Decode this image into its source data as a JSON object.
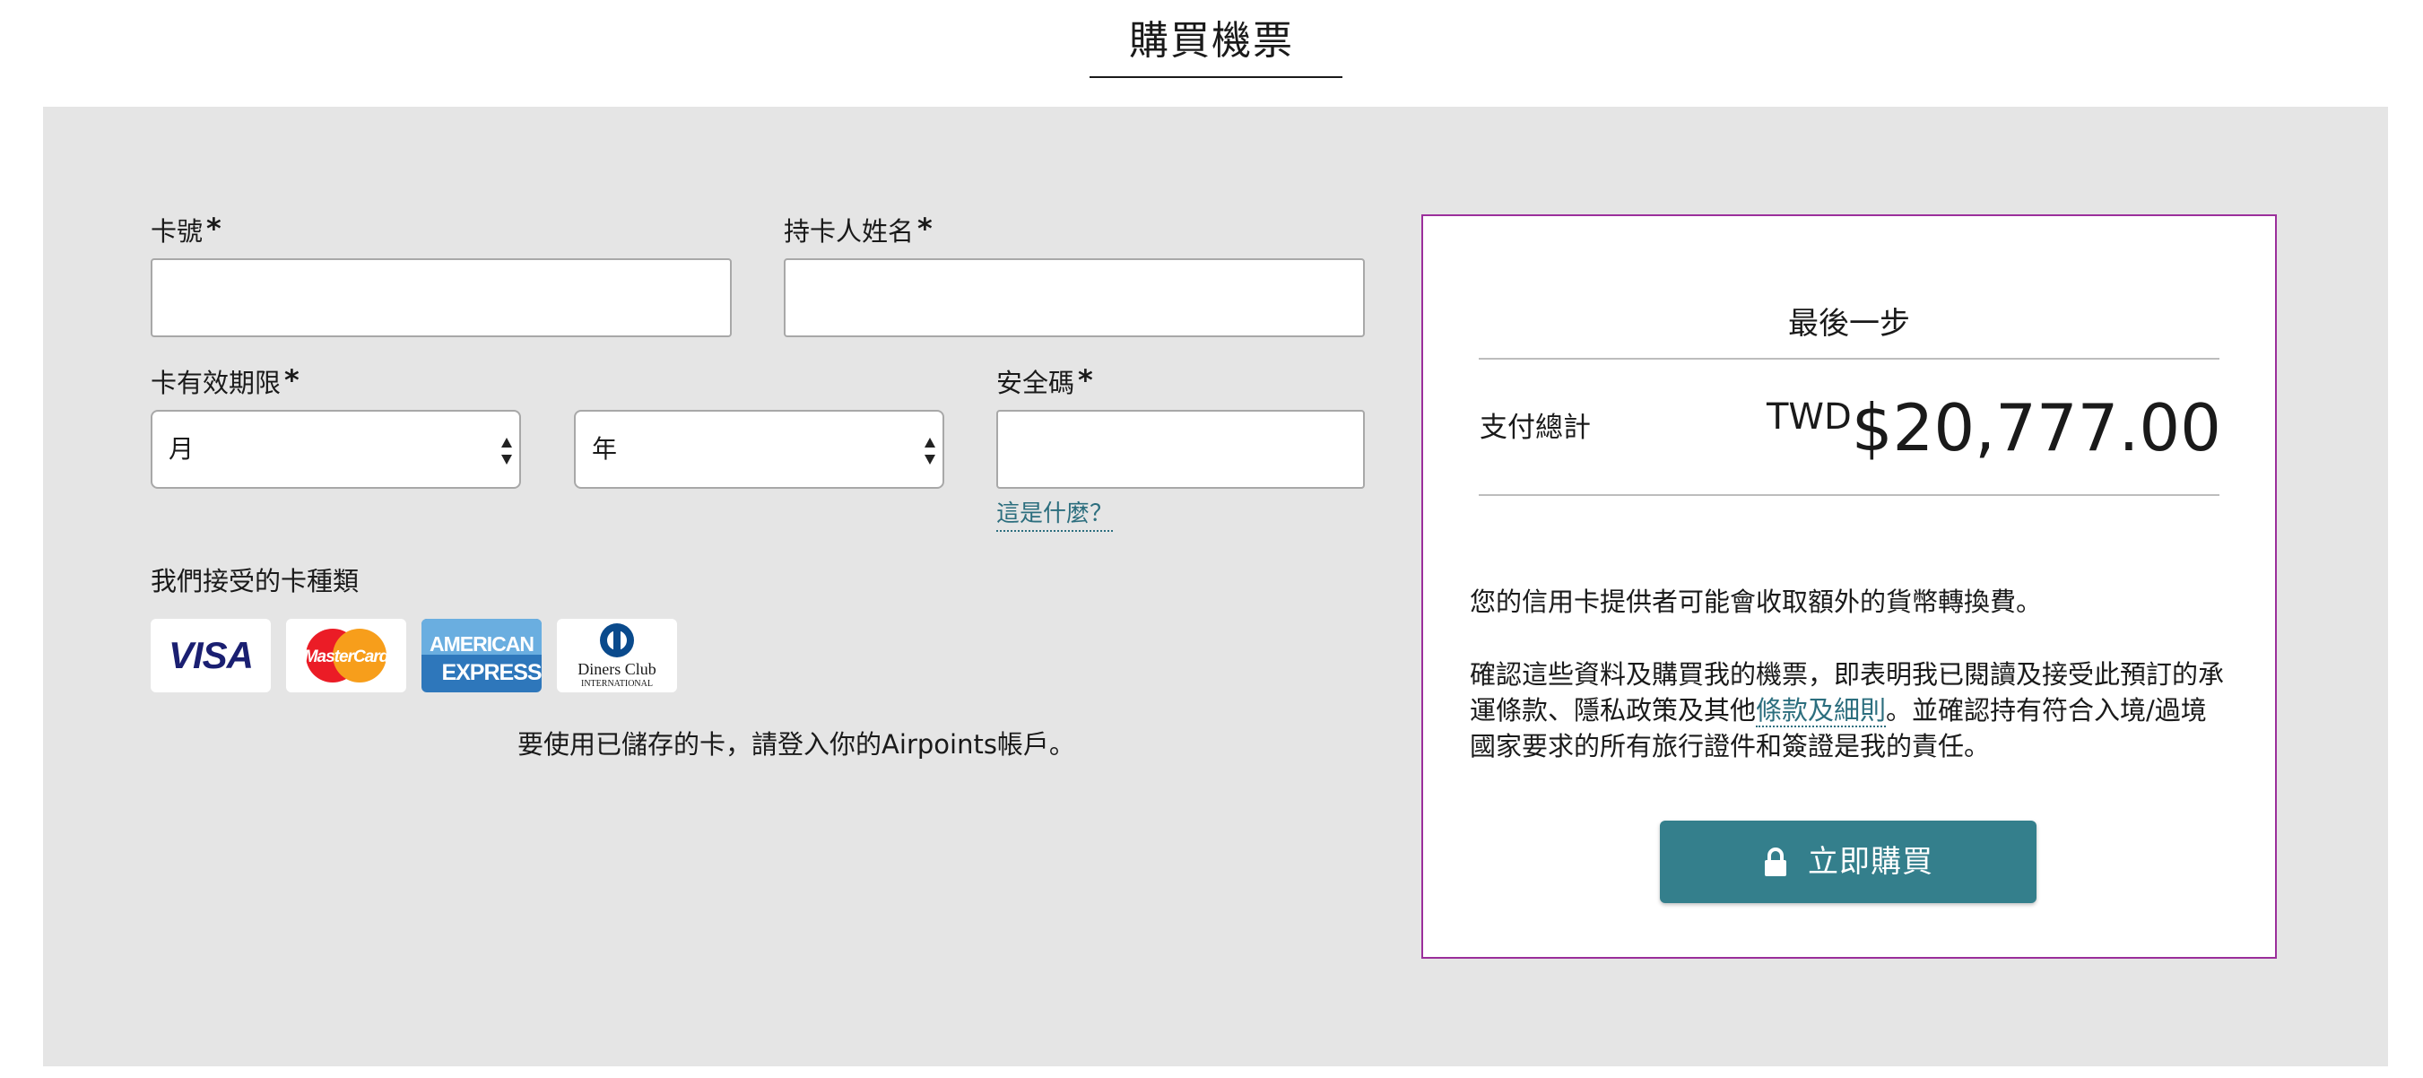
{
  "page": {
    "title": "購買機票"
  },
  "form": {
    "card_number": {
      "label": "卡號",
      "required_mark": "*",
      "value": ""
    },
    "cardholder_name": {
      "label": "持卡人姓名",
      "required_mark": "*",
      "value": ""
    },
    "expiry": {
      "label": "卡有效期限",
      "required_mark": "*",
      "month_selected": "月",
      "year_selected": "年"
    },
    "security_code": {
      "label": "安全碼",
      "required_mark": "*",
      "value": "",
      "help_link": "這是什麼？"
    },
    "accepted_cards": {
      "label": "我們接受的卡種類",
      "cards": [
        "visa-icon",
        "mastercard-icon",
        "american-express-icon",
        "diners-club-icon"
      ],
      "visa_text": "VISA",
      "mastercard_text": "MasterCard",
      "amex_line1": "AMERICAN",
      "amex_line2": "EXPRESS",
      "diners_line1": "Diners Club",
      "diners_line2": "INTERNATIONAL"
    },
    "saved_card_note": "要使用已儲存的卡，請登入你的Airpoints帳戶。"
  },
  "summary": {
    "title": "最後一步",
    "total_label": "支付總計",
    "currency": "TWD",
    "amount": "$20,777.00",
    "fx_notice": "您的信用卡提供者可能會收取額外的貨幣轉換費。",
    "terms_before": "確認這些資料及購買我的機票，即表明我已閱讀及接受此預訂的承運條款、隱私政策及其他",
    "terms_link": "條款及細則",
    "terms_after": "。並確認持有符合入境/過境國家要求的所有旅行證件和簽證是我的責任。",
    "buy_button": "立即購買",
    "button_icon": "lock-icon"
  },
  "colors": {
    "panel_bg": "#e5e5e5",
    "accent": "#347f8c",
    "link": "#2c6e7e",
    "summary_border": "#9b2f9b"
  }
}
